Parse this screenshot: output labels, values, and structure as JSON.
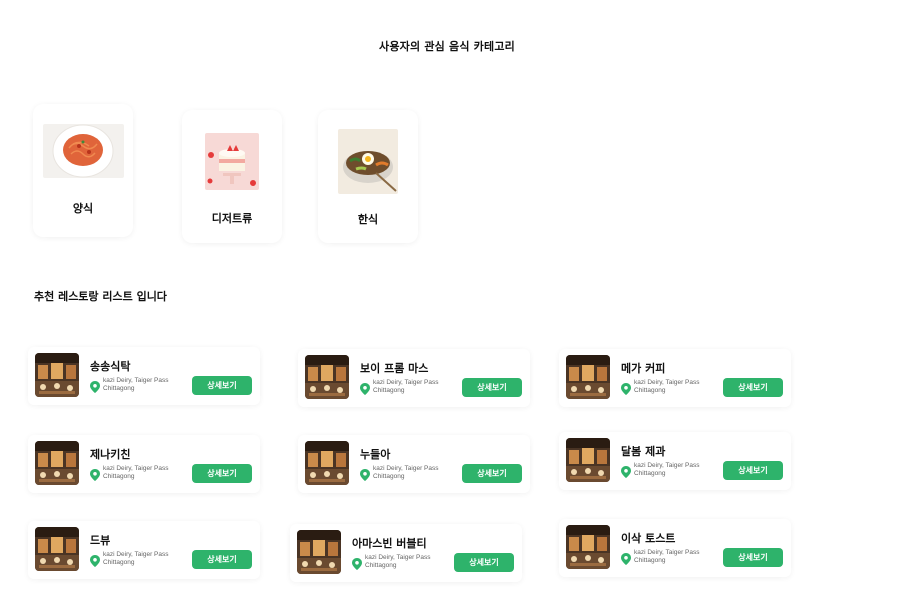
{
  "page": {
    "title": "사용자의 관심 음식 카테고리"
  },
  "categories": [
    {
      "label": "양식",
      "icon": "pasta-image"
    },
    {
      "label": "디저트류",
      "icon": "cake-image"
    },
    {
      "label": "한식",
      "icon": "bibimbap-image"
    }
  ],
  "section": {
    "title": "추천 레스토랑 리스트 입니다"
  },
  "restaurants": [
    {
      "name": "송송식탁",
      "address_line1": "kazi Deiry, Taiger Pass",
      "address_line2": "Chittagong",
      "button": "상세보기"
    },
    {
      "name": "보이 프롬 마스",
      "address_line1": "kazi Deiry, Taiger Pass",
      "address_line2": "Chittagong",
      "button": "상세보기"
    },
    {
      "name": "메가 커피",
      "address_line1": "kazi Deiry, Taiger Pass",
      "address_line2": "Chittagong",
      "button": "상세보기"
    },
    {
      "name": "제나키친",
      "address_line1": "kazi Deiry, Taiger Pass",
      "address_line2": "Chittagong",
      "button": "상세보기"
    },
    {
      "name": "누들아",
      "address_line1": "kazi Deiry, Taiger Pass",
      "address_line2": "Chittagong",
      "button": "상세보기"
    },
    {
      "name": "달봄 제과",
      "address_line1": "kazi Deiry, Taiger Pass",
      "address_line2": "Chittagong",
      "button": "상세보기"
    },
    {
      "name": "드뷰",
      "address_line1": "kazi Deiry, Taiger Pass",
      "address_line2": "Chittagong",
      "button": "상세보기"
    },
    {
      "name": "아마스빈 버블티",
      "address_line1": "kazi Deiry, Taiger Pass",
      "address_line2": "Chittagong",
      "button": "상세보기"
    },
    {
      "name": "이삭 토스트",
      "address_line1": "kazi Deiry, Taiger Pass",
      "address_line2": "Chittagong",
      "button": "상세보기"
    }
  ],
  "colors": {
    "accent": "#2eb36b",
    "text": "#111111",
    "muted": "#666666"
  }
}
